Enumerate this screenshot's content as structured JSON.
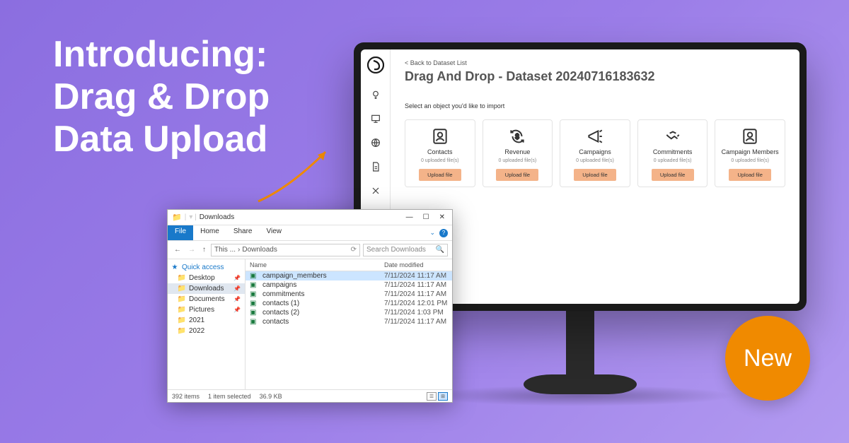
{
  "headline": "Introducing:\nDrag & Drop\nData Upload",
  "badge_text": "New",
  "app": {
    "back_link": "< Back to Dataset List",
    "page_title": "Drag And Drop - Dataset 20240716183632",
    "instruction": "Select an object you'd like to import",
    "cards": [
      {
        "title": "Contacts",
        "sub": "0 uploaded file(s)",
        "btn": "Upload file",
        "icon": "contact"
      },
      {
        "title": "Revenue",
        "sub": "0 uploaded file(s)",
        "btn": "Upload file",
        "icon": "revenue"
      },
      {
        "title": "Campaigns",
        "sub": "0 uploaded file(s)",
        "btn": "Upload file",
        "icon": "campaign"
      },
      {
        "title": "Commitments",
        "sub": "0 uploaded file(s)",
        "btn": "Upload file",
        "icon": "commit"
      },
      {
        "title": "Campaign Members",
        "sub": "0 uploaded file(s)",
        "btn": "Upload file",
        "icon": "contact"
      }
    ]
  },
  "explorer": {
    "title": "Downloads",
    "tabs": {
      "file": "File",
      "home": "Home",
      "share": "Share",
      "view": "View"
    },
    "path_prefix": "This ...",
    "path_current": "Downloads",
    "search_placeholder": "Search Downloads",
    "nav": [
      {
        "type": "top",
        "label": "Quick access"
      },
      {
        "label": "Desktop",
        "pin": true
      },
      {
        "label": "Downloads",
        "pin": true,
        "selected": true
      },
      {
        "label": "Documents",
        "pin": true
      },
      {
        "label": "Pictures",
        "pin": true
      },
      {
        "label": "2021"
      },
      {
        "label": "2022"
      }
    ],
    "columns": {
      "name": "Name",
      "modified": "Date modified"
    },
    "files": [
      {
        "name": "campaign_members",
        "modified": "7/11/2024 11:17 AM",
        "selected": true
      },
      {
        "name": "campaigns",
        "modified": "7/11/2024 11:17 AM"
      },
      {
        "name": "commitments",
        "modified": "7/11/2024 11:17 AM"
      },
      {
        "name": "contacts (1)",
        "modified": "7/11/2024 12:01 PM"
      },
      {
        "name": "contacts (2)",
        "modified": "7/11/2024 1:03 PM"
      },
      {
        "name": "contacts",
        "modified": "7/11/2024 11:17 AM"
      }
    ],
    "status": {
      "count": "392 items",
      "selected": "1 item selected",
      "size": "36.9 KB"
    }
  }
}
